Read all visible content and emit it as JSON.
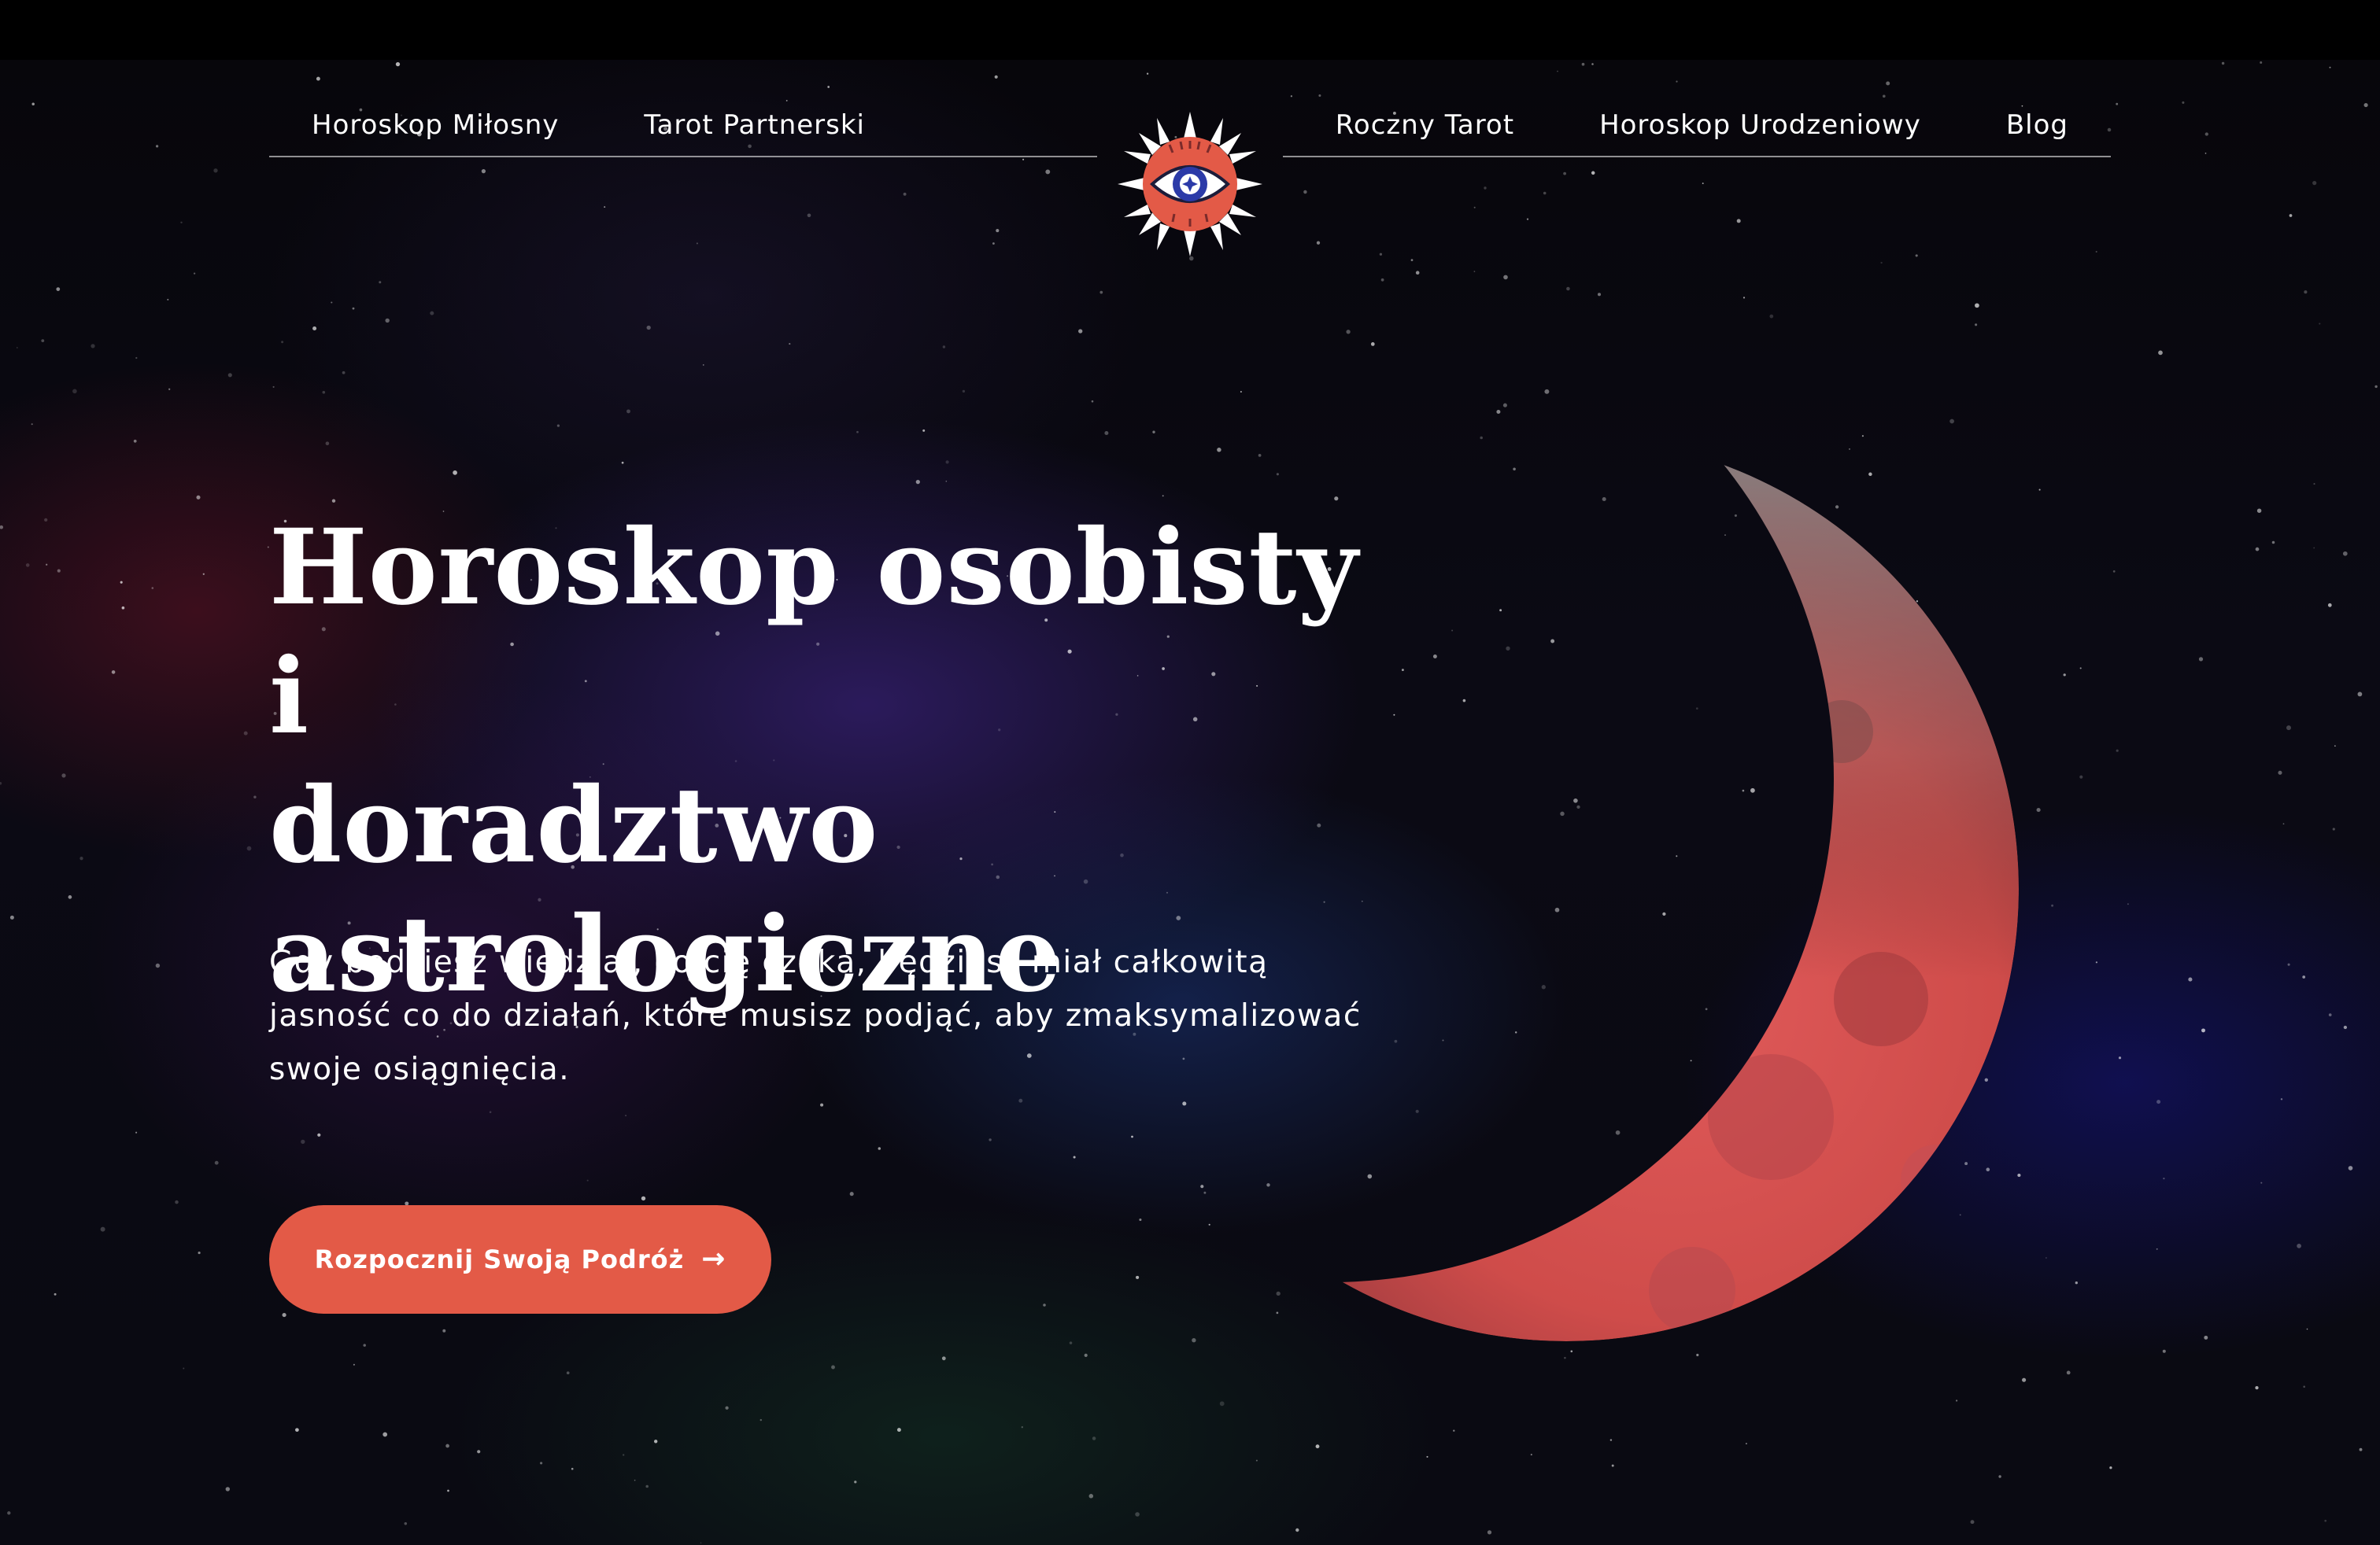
{
  "nav": {
    "left": [
      {
        "label": "Horoskop Miłosny"
      },
      {
        "label": "Tarot Partnerski"
      }
    ],
    "right": [
      {
        "label": "Roczny Tarot"
      },
      {
        "label": "Horoskop Urodzeniowy"
      },
      {
        "label": "Blog"
      }
    ],
    "logo_icon": "sun-eye-logo-icon"
  },
  "hero": {
    "title_lines": [
      "Horoskop osobisty i",
      "doradztwo",
      "astrologiczne"
    ],
    "subtitle_lines": [
      "Gdy będziesz wiedział, co cię czeka, będziesz miał całkowitą",
      "jasność co do działań, które musisz podjąć, aby zmaksymalizować",
      "swoje osiągnięcia."
    ],
    "cta_label": "Rozpocznij Swoją Podróż",
    "cta_icon": "arrow-right-icon",
    "moon_image": "red-crescent-moon"
  },
  "colors": {
    "accent": "#e35a47",
    "text": "#ffffff",
    "background": "#000000",
    "moon": "#d4504a"
  }
}
